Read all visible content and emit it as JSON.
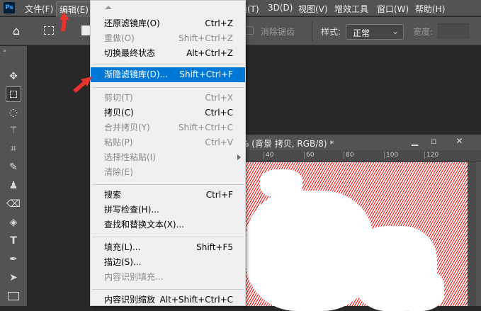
{
  "app": {
    "logo": "Ps"
  },
  "menubar": {
    "items": [
      "文件(F)",
      "编辑(E)",
      "滤镜(T)",
      "3D(D)",
      "视图(V)",
      "增效工具",
      "窗口(W)",
      "帮助(H)"
    ]
  },
  "options": {
    "antialias": "消除锯齿",
    "style_label": "样式:",
    "style_value": "正常",
    "width_label": "宽度:"
  },
  "document": {
    "title": "% (背景 拷贝, RGB/8) *",
    "ruler": [
      "40",
      "60",
      "80",
      "100",
      "120"
    ]
  },
  "edit_menu": {
    "items": [
      {
        "label": "还原滤镜库(O)",
        "shortcut": "Ctrl+Z",
        "enabled": true
      },
      {
        "label": "重做(O)",
        "shortcut": "Shift+Ctrl+Z",
        "enabled": false
      },
      {
        "label": "切换最终状态",
        "shortcut": "Alt+Ctrl+Z",
        "enabled": true
      },
      {
        "label": "渐隐滤镜库(D)...",
        "shortcut": "Shift+Ctrl+F",
        "enabled": true,
        "highlighted": true
      },
      {
        "label": "剪切(T)",
        "shortcut": "Ctrl+X",
        "enabled": false
      },
      {
        "label": "拷贝(C)",
        "shortcut": "Ctrl+C",
        "enabled": true
      },
      {
        "label": "合并拷贝(Y)",
        "shortcut": "Shift+Ctrl+C",
        "enabled": false
      },
      {
        "label": "粘贴(P)",
        "shortcut": "Ctrl+V",
        "enabled": false
      },
      {
        "label": "选择性粘贴(I)",
        "shortcut": "",
        "enabled": false,
        "submenu": true
      },
      {
        "label": "清除(E)",
        "shortcut": "",
        "enabled": false
      },
      {
        "label": "搜索",
        "shortcut": "Ctrl+F",
        "enabled": true
      },
      {
        "label": "拼写检查(H)...",
        "shortcut": "",
        "enabled": true
      },
      {
        "label": "查找和替换文本(X)...",
        "shortcut": "",
        "enabled": true
      },
      {
        "label": "填充(L)...",
        "shortcut": "Shift+F5",
        "enabled": true
      },
      {
        "label": "描边(S)...",
        "shortcut": "",
        "enabled": true
      },
      {
        "label": "内容识别填充...",
        "shortcut": "",
        "enabled": false
      },
      {
        "label": "内容识别缩放",
        "shortcut": "Alt+Shift+Ctrl+C",
        "enabled": true
      }
    ]
  },
  "colors": {
    "highlight": "#0078d7",
    "annotation_arrow": "#e8322b"
  }
}
